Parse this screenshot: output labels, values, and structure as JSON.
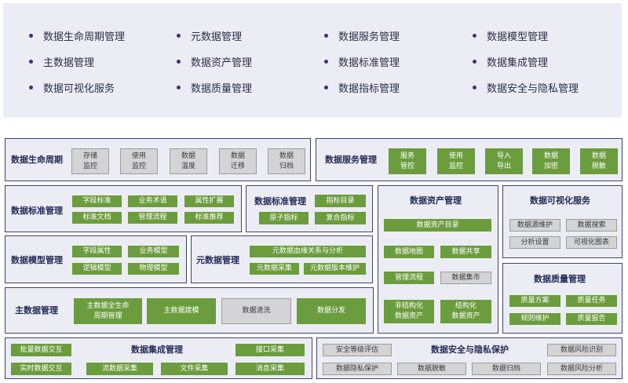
{
  "legend": [
    "数据生命周期管理",
    "元数据管理",
    "数据服务管理",
    "数据模型管理",
    "主数据管理",
    "数据资产管理",
    "数据标准管理",
    "数据集成管理",
    "数据可视化服务",
    "数据质量管理",
    "数据指标管理",
    "数据安全与隐私管理"
  ],
  "lifecycle": {
    "title": "数据生命周期",
    "items": [
      "存储\n监控",
      "使用\n监控",
      "数据\n温度",
      "数据\n迁移",
      "数据\n归档"
    ]
  },
  "service": {
    "title": "数据服务管理",
    "items": [
      "服务\n管控",
      "使用\n监控",
      "导入\n导出",
      "数据\n加密",
      "数据\n脱敏"
    ]
  },
  "standard": {
    "title": "数据标准管理",
    "items": [
      "字段标准",
      "业务术语",
      "属性扩展",
      "标准文档",
      "管理流程",
      "标准推荐"
    ]
  },
  "indicator": {
    "title": "数据标准管理",
    "items": [
      "指标目录",
      "原子指标",
      "复合指标"
    ]
  },
  "asset": {
    "title": "数据资产管理",
    "items": [
      "数据资产目录",
      "数据地图",
      "数据共享",
      "管理流程",
      "数据集市",
      "非结构化\n数据资产",
      "结构化\n数据资产"
    ]
  },
  "visual": {
    "title": "数据可视化服务",
    "items": [
      "数据源维护",
      "数据搜索",
      "分析设置",
      "可视化图表"
    ]
  },
  "model": {
    "title": "数据模型管理",
    "items": [
      "字段属性",
      "业务模型",
      "逻辑模型",
      "物理模型"
    ]
  },
  "meta": {
    "title": "元数据管理",
    "items": [
      "元数据血缘关系与分析",
      "元数据采集",
      "元数据版本维护"
    ]
  },
  "quality": {
    "title": "数据质量管理",
    "items": [
      "质量方案",
      "质量任务",
      "规则维护",
      "质量报告"
    ]
  },
  "master": {
    "title": "主数据管理",
    "items": [
      "主数据全生命\n周期管理",
      "主数据建模",
      "数据清洗",
      "数据分发"
    ]
  },
  "integration": {
    "title": "数据集成管理",
    "items": [
      "批量数据交互",
      "接口采集",
      "实时数据交互",
      "流数据采集",
      "文件采集",
      "消息采集"
    ]
  },
  "security": {
    "title": "数据安全与隐私保护",
    "items": [
      "安全等级评估",
      "数据风险识别",
      "数据隐私保护",
      "数据脱敏",
      "数据归档",
      "数据风险分析"
    ]
  },
  "colors": {
    "green": "#6b9c3d",
    "gray": "#d4d4d6",
    "panel_bg": "#ecedf4",
    "border": "#3d4370",
    "title": "#252a57"
  }
}
